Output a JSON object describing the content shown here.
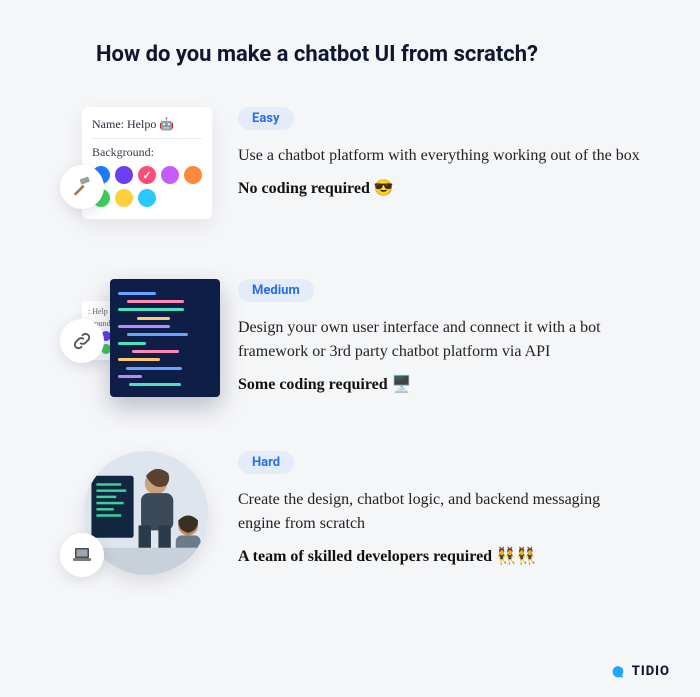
{
  "title": "How do you make a chatbot UI from scratch?",
  "rows": [
    {
      "badge": "Easy",
      "desc": "Use a chatbot platform with everything working out of the box",
      "note": "No coding required",
      "emoji": "😎"
    },
    {
      "badge": "Medium",
      "desc": "Design your own user interface and connect it with a bot framework or 3rd party chatbot platform via API",
      "note": "Some coding required",
      "emoji": "🖥️"
    },
    {
      "badge": "Hard",
      "desc": "Create the design, chatbot logic, and backend messaging engine from scratch",
      "note": "A team of skilled developers required",
      "emoji": "👯👯"
    }
  ],
  "card": {
    "name_label": "Name:",
    "name_value": "Helpo 🤖",
    "bg_label": "Background:",
    "swatches": [
      "#1f7bff",
      "#6a3ff0",
      "#ff4d7a",
      "#c45cff",
      "#ff8a3d",
      "#3fcf5b",
      "#ffcf3d",
      "#2ac8ff"
    ],
    "checked_index": 2
  },
  "brand": "TIDIO"
}
